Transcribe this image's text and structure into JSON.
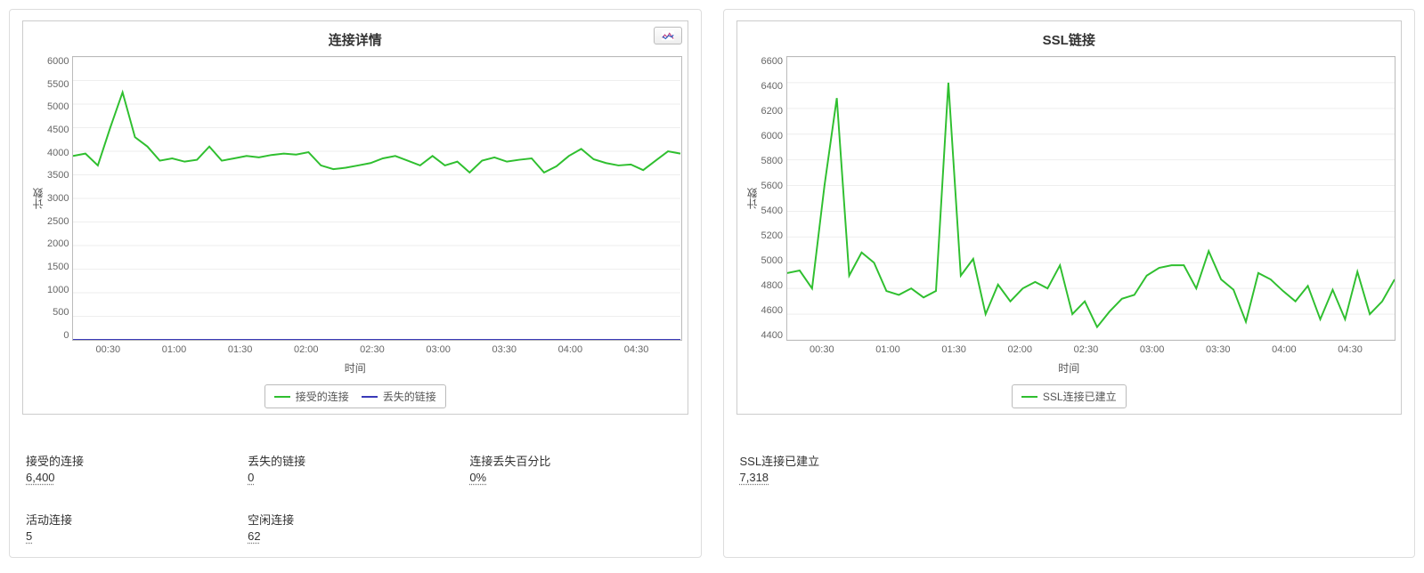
{
  "chart_data": [
    {
      "type": "line",
      "title": "连接详情",
      "xlabel": "时间",
      "ylabel": "计数",
      "ylim": [
        0,
        6000
      ],
      "yticks": [
        0,
        500,
        1000,
        1500,
        2000,
        2500,
        3000,
        3500,
        4000,
        4500,
        5000,
        5500,
        6000
      ],
      "xticks": [
        "00:30",
        "01:00",
        "01:30",
        "02:00",
        "02:30",
        "03:00",
        "03:30",
        "04:00",
        "04:30"
      ],
      "series": [
        {
          "name": "接受的连接",
          "color": "#2fbf2f",
          "values": [
            3900,
            3950,
            3700,
            4500,
            5250,
            4300,
            4100,
            3800,
            3850,
            3780,
            3820,
            4100,
            3800,
            3850,
            3900,
            3870,
            3920,
            3950,
            3930,
            3980,
            3700,
            3620,
            3650,
            3700,
            3750,
            3850,
            3900,
            3800,
            3700,
            3900,
            3700,
            3780,
            3550,
            3800,
            3870,
            3780,
            3820,
            3850,
            3550,
            3680,
            3900,
            4050,
            3830,
            3750,
            3700,
            3720,
            3600,
            3800,
            4000,
            3950
          ]
        },
        {
          "name": "丢失的链接",
          "color": "#3a3ab8",
          "values": [
            0,
            0,
            0,
            0,
            0,
            0,
            0,
            0,
            0,
            0,
            0,
            0,
            0,
            0,
            0,
            0,
            0,
            0,
            0,
            0,
            0,
            0,
            0,
            0,
            0,
            0,
            0,
            0,
            0,
            0,
            0,
            0,
            0,
            0,
            0,
            0,
            0,
            0,
            0,
            0,
            0,
            0,
            0,
            0,
            0,
            0,
            0,
            0,
            0,
            0
          ]
        }
      ]
    },
    {
      "type": "line",
      "title": "SSL链接",
      "xlabel": "时间",
      "ylabel": "计数",
      "ylim": [
        4400,
        6600
      ],
      "yticks": [
        4400,
        4600,
        4800,
        5000,
        5200,
        5400,
        5600,
        5800,
        6000,
        6200,
        6400,
        6600
      ],
      "xticks": [
        "00:30",
        "01:00",
        "01:30",
        "02:00",
        "02:30",
        "03:00",
        "03:30",
        "04:00",
        "04:30"
      ],
      "series": [
        {
          "name": "SSL连接已建立",
          "color": "#2fbf2f",
          "values": [
            4920,
            4940,
            4800,
            5600,
            6280,
            4900,
            5080,
            5000,
            4780,
            4750,
            4800,
            4730,
            4780,
            6400,
            4900,
            5030,
            4600,
            4830,
            4700,
            4800,
            4850,
            4800,
            4980,
            4600,
            4700,
            4500,
            4620,
            4720,
            4750,
            4900,
            4960,
            4980,
            4980,
            4800,
            5090,
            4870,
            4790,
            4540,
            4920,
            4870,
            4780,
            4700,
            4820,
            4560,
            4790,
            4560,
            4930,
            4600,
            4700,
            4870
          ]
        }
      ]
    }
  ],
  "left_stats": {
    "accepted_label": "接受的连接",
    "accepted_value": "6,400",
    "dropped_label": "丢失的链接",
    "dropped_value": "0",
    "drop_pct_label": "连接丢失百分比",
    "drop_pct_value": "0%",
    "active_label": "活动连接",
    "active_value": "5",
    "idle_label": "空闲连接",
    "idle_value": "62"
  },
  "right_stats": {
    "ssl_established_label": "SSL连接已建立",
    "ssl_established_value": "7,318"
  }
}
